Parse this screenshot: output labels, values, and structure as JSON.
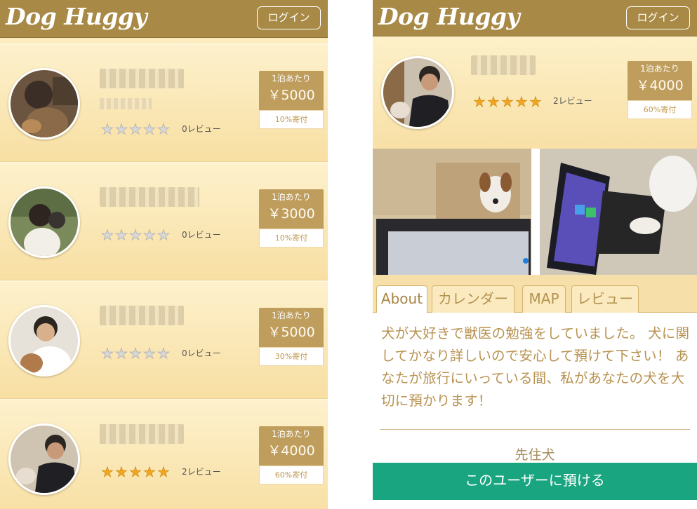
{
  "app": {
    "logo_text": "Dog Huggy",
    "login_label": "ログイン"
  },
  "list": {
    "items": [
      {
        "rating": 0,
        "reviews": "0レビュー",
        "price_per": "1泊あたり",
        "price": "￥5000",
        "donation": "10%寄付"
      },
      {
        "rating": 0,
        "reviews": "0レビュー",
        "price_per": "1泊あたり",
        "price": "￥3000",
        "donation": "10%寄付"
      },
      {
        "rating": 0,
        "reviews": "0レビュー",
        "price_per": "1泊あたり",
        "price": "￥5000",
        "donation": "30%寄付"
      },
      {
        "rating": 5,
        "reviews": "2レビュー",
        "price_per": "1泊あたり",
        "price": "￥4000",
        "donation": "60%寄付"
      }
    ]
  },
  "detail": {
    "rating": 5,
    "reviews": "2レビュー",
    "price_per": "1泊あたり",
    "price": "￥4000",
    "donation": "60%寄付",
    "tabs": [
      "About",
      "カレンダー",
      "MAP",
      "レビュー"
    ],
    "active_tab": "About",
    "about_text": "犬が大好きで獣医の勉強をしていました。 犬に関してかなり詳しいので安心して預けて下さい！ あなたが旅行にいっている間、私があなたの犬を大切に預かります！",
    "dogs_heading": "先住犬",
    "cta_label": "このユーザーに預ける"
  },
  "colors": {
    "header": "#a88a46",
    "card_bg": "#fcecc0",
    "price_bg": "#bf9d5c",
    "cta": "#1aa581",
    "star_on": "#f2a51d",
    "text_accent": "#b89250"
  },
  "icons": {
    "star_filled": "★",
    "star_empty": "☆"
  }
}
